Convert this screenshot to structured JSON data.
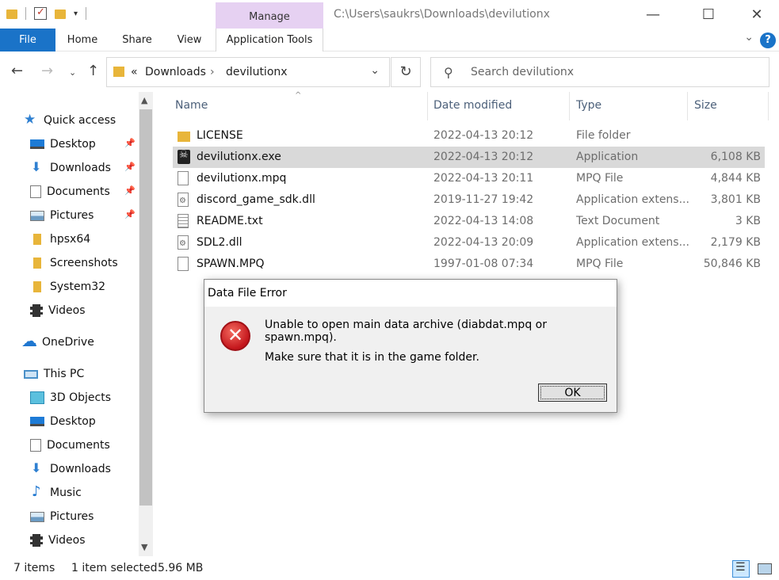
{
  "window": {
    "path": "C:\\Users\\saukrs\\Downloads\\devilutionx",
    "context_tab": "Manage"
  },
  "ribbon": {
    "tabs": [
      "File",
      "Home",
      "Share",
      "View",
      "Application Tools"
    ]
  },
  "nav": {
    "breadcrumb_prefix": "«",
    "crumbs": [
      "Downloads",
      "devilutionx"
    ],
    "search_placeholder": "Search devilutionx"
  },
  "sidebar": {
    "items": [
      {
        "label": "Quick access",
        "icon": "star-icon"
      },
      {
        "label": "Desktop",
        "icon": "desktop-icon",
        "pinned": true
      },
      {
        "label": "Downloads",
        "icon": "download-icon",
        "pinned": true
      },
      {
        "label": "Documents",
        "icon": "documents-icon",
        "pinned": true
      },
      {
        "label": "Pictures",
        "icon": "pictures-icon",
        "pinned": true
      },
      {
        "label": "hpsx64",
        "icon": "folder-icon"
      },
      {
        "label": "Screenshots",
        "icon": "folder-icon"
      },
      {
        "label": "System32",
        "icon": "folder-icon"
      },
      {
        "label": "Videos",
        "icon": "videos-icon"
      },
      {
        "label": "OneDrive",
        "icon": "cloud-icon"
      },
      {
        "label": "This PC",
        "icon": "computer-icon"
      },
      {
        "label": "3D Objects",
        "icon": "cube-icon"
      },
      {
        "label": "Desktop",
        "icon": "desktop-icon"
      },
      {
        "label": "Documents",
        "icon": "documents-icon"
      },
      {
        "label": "Downloads",
        "icon": "download-icon"
      },
      {
        "label": "Music",
        "icon": "music-icon"
      },
      {
        "label": "Pictures",
        "icon": "pictures-icon"
      },
      {
        "label": "Videos",
        "icon": "videos-icon"
      }
    ]
  },
  "files": {
    "columns": [
      "Name",
      "Date modified",
      "Type",
      "Size"
    ],
    "rows": [
      {
        "name": "LICENSE",
        "date": "2022-04-13 20:12",
        "type": "File folder",
        "size": "",
        "icon": "folder-icon"
      },
      {
        "name": "devilutionx.exe",
        "date": "2022-04-13 20:12",
        "type": "Application",
        "size": "6,108 KB",
        "icon": "exe-icon",
        "selected": true
      },
      {
        "name": "devilutionx.mpq",
        "date": "2022-04-13 20:11",
        "type": "MPQ File",
        "size": "4,844 KB",
        "icon": "file-icon"
      },
      {
        "name": "discord_game_sdk.dll",
        "date": "2019-11-27 19:42",
        "type": "Application extens...",
        "size": "3,801 KB",
        "icon": "dll-icon"
      },
      {
        "name": "README.txt",
        "date": "2022-04-13 14:08",
        "type": "Text Document",
        "size": "3 KB",
        "icon": "text-file-icon"
      },
      {
        "name": "SDL2.dll",
        "date": "2022-04-13 20:09",
        "type": "Application extens...",
        "size": "2,179 KB",
        "icon": "dll-icon"
      },
      {
        "name": "SPAWN.MPQ",
        "date": "1997-01-08 07:34",
        "type": "MPQ File",
        "size": "50,846 KB",
        "icon": "file-icon"
      }
    ]
  },
  "status": {
    "count": "7 items",
    "selection": "1 item selected",
    "size": "5.96 MB"
  },
  "dialog": {
    "title": "Data File Error",
    "message1": "Unable to open main data archive (diabdat.mpq or spawn.mpq).",
    "message2": "Make sure that it is in the game folder.",
    "ok_label": "OK"
  },
  "colors": {
    "file_tab": "#1a73c8",
    "manage_tab": "#e6d1f2",
    "selected_row": "#d9d9d9",
    "error_icon": "#c4161c"
  }
}
